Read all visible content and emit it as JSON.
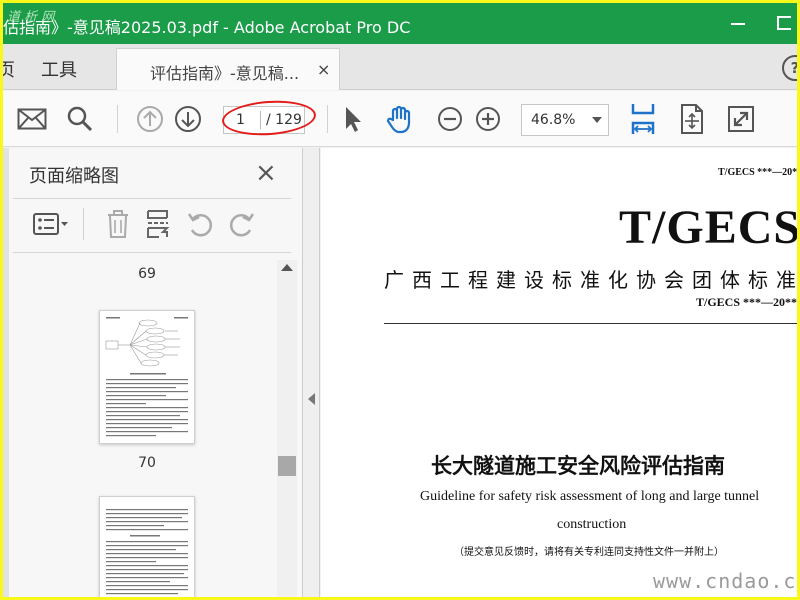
{
  "window": {
    "title": "估指南》-意见稿2025.03.pdf - Adobe Acrobat Pro DC",
    "logo_text": "道 析 网"
  },
  "menu": {
    "home_label": "页",
    "tools_label": "工具",
    "doc_tab_label": "评估指南》-意见稿...",
    "doc_tab_close": "×",
    "help": "?"
  },
  "toolbar": {
    "current_page": "1",
    "total_pages": "/ 129",
    "zoom": "46.8%",
    "icons": [
      "mail-icon",
      "search-icon",
      "prev-page-icon",
      "next-page-icon",
      "select-arrow-icon",
      "hand-icon",
      "zoom-out-icon",
      "zoom-in-icon",
      "fit-width-icon",
      "rotate-view-icon",
      "fullscreen-icon"
    ]
  },
  "thumbnails_pane": {
    "title": "页面缩略图",
    "close": "×",
    "pages": [
      {
        "label": "69"
      },
      {
        "label": "70"
      }
    ]
  },
  "document": {
    "code_top": "T/GECS ***—20**",
    "standard_big": "T/GECS",
    "organization": "广西工程建设标准化协会团体标准",
    "code_line2": "T/GECS ***—20**",
    "title_cn": "长大隧道施工安全风险评估指南",
    "title_en_line1": "Guideline for safety risk assessment of long and large tunnel",
    "title_en_line2": "construction",
    "note": "（提交意见反馈时，请将有关专利连同支持性文件一并附上）"
  },
  "watermark": "www.cndao.com",
  "colors": {
    "titlebar": "#1a9c49",
    "border": "#f8f81a",
    "annotation_ring": "#e31b1b",
    "accent_blue": "#1e73c8"
  }
}
